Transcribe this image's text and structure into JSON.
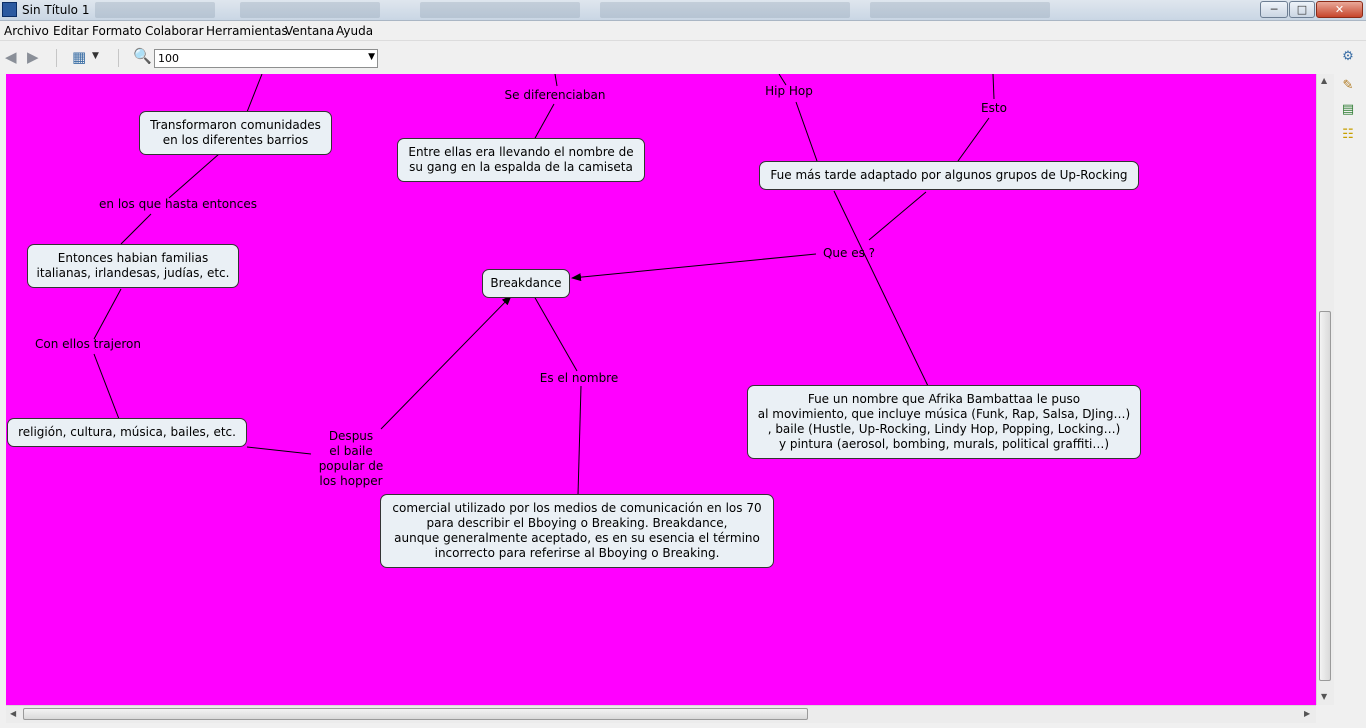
{
  "window": {
    "title": "Sin Título 1",
    "minimize": "─",
    "maximize": "□",
    "close": "✕"
  },
  "menu": [
    "Archivo",
    "Editar",
    "Formato",
    "Colaborar",
    "Herramientas",
    "Ventana",
    "Ayuda"
  ],
  "toolbar": {
    "zoom_value": "100",
    "back_icon": "back-arrow-icon",
    "forward_icon": "forward-arrow-icon",
    "layout_icon": "layout-icon",
    "zoom_icon": "zoom-icon"
  },
  "canvas": {
    "background": "#ff00ff"
  },
  "concepts": {
    "breakdance": "Breakdance",
    "transformaron": "Transformaron comunidades\nen los diferentes barrios",
    "entre_ellas": "Entre ellas era llevando el nombre de\nsu gang en la espalda de la camiseta",
    "fue_mas_tarde": "Fue más tarde adaptado por algunos grupos de Up-Rocking",
    "familias": "Entonces habian familias\nitalianas, irlandesas, judías, etc.",
    "religion": "religión, cultura, música, bailes, etc.",
    "afrika": "Fue un nombre que Afrika Bambattaa le puso\nal movimiento, que incluye música (Funk, Rap, Salsa, DJing…)\n, baile (Hustle, Up-Rocking, Lindy Hop, Popping, Locking…)\ny pintura (aerosol, bombing, murals, political graffiti…)",
    "comercial": "comercial utilizado por los medios de comunicación en los 70\npara describir el Bboying o Breaking. Breakdance,\naunque generalmente aceptado, es en su esencia el término\nincorrecto para referirse al Bboying o Breaking."
  },
  "links": {
    "se_diferenciaban": "Se diferenciaban",
    "hip_hop": "Hip Hop",
    "esto": "Esto",
    "en_los_que": "en los que hasta entonces",
    "que_es": "Que es ?",
    "con_ellos": "Con ellos trajeron",
    "es_el_nombre": "Es el nombre",
    "despues": "Despus\nel baile\npopular de\nlos hopper"
  }
}
